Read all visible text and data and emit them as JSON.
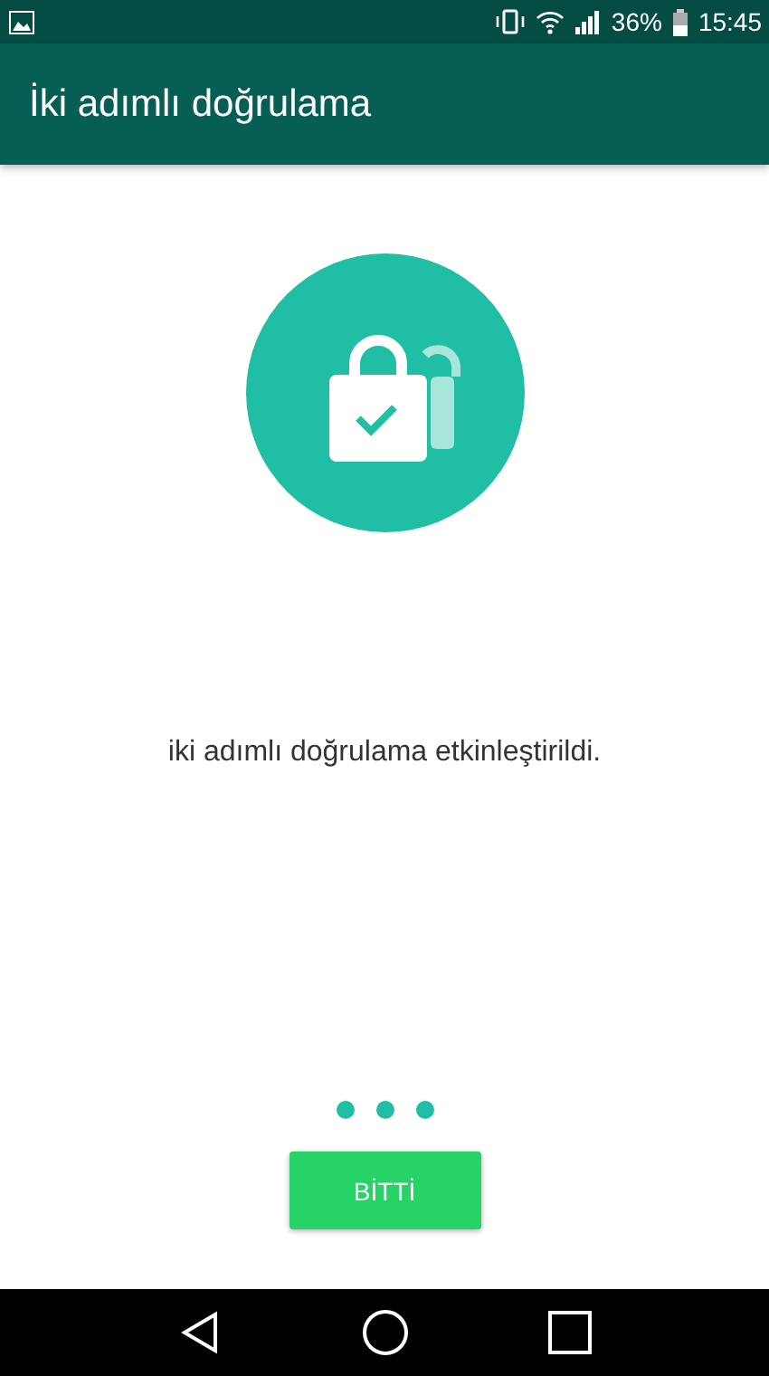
{
  "status_bar": {
    "battery": "36%",
    "time": "15:45"
  },
  "app_bar": {
    "title": "İki adımlı doğrulama"
  },
  "message": "iki adımlı doğrulama etkinleştirildi.",
  "done_button": {
    "label": "BİTTİ"
  }
}
